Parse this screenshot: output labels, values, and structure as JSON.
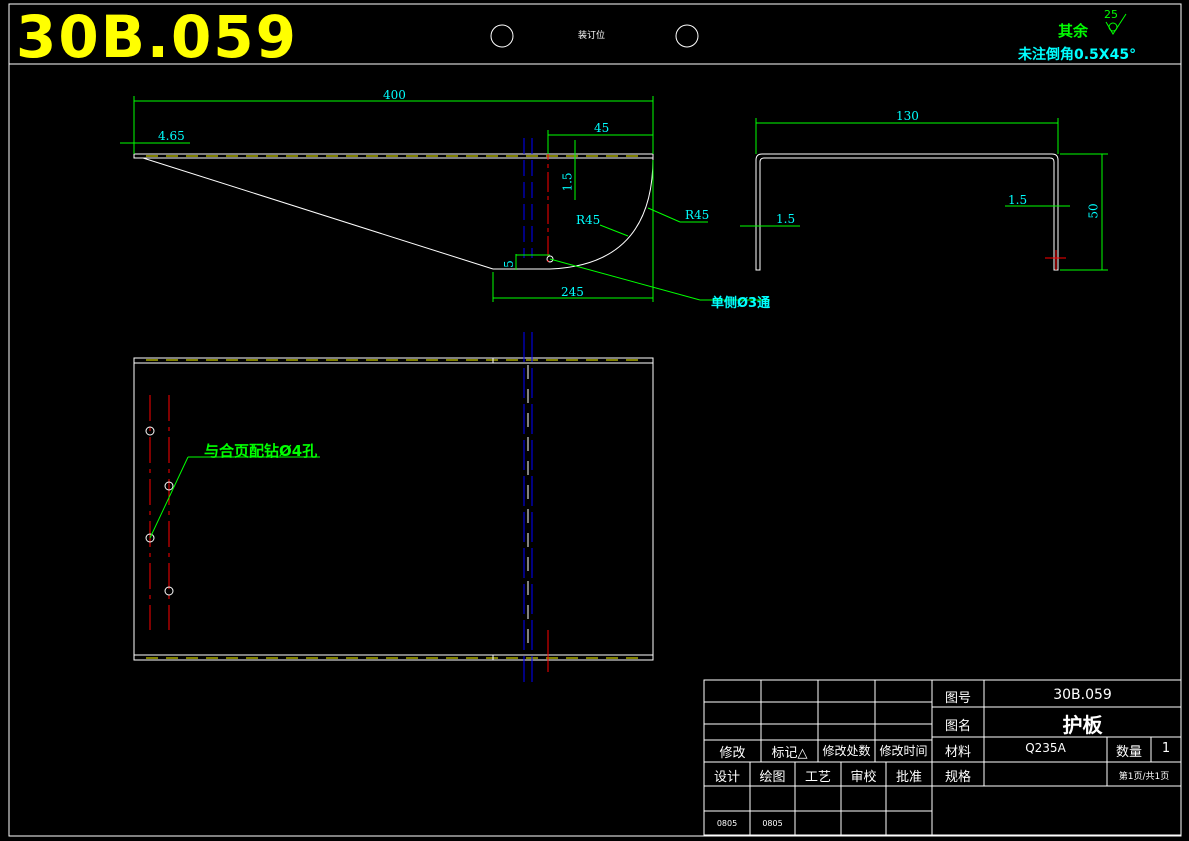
{
  "header": {
    "drawing_number_large": "30B.059",
    "binding_label": "装订位"
  },
  "surface": {
    "rough_label": "其余",
    "rough_value": "25",
    "chamfer_note": "未注倒角0.5X45°"
  },
  "front_view": {
    "dim_total_length": "400",
    "dim_left_offset": "4.65",
    "dim_right_top": "45",
    "dim_thickness": "1.5",
    "dim_radius_inner": "R45",
    "dim_radius_outer": "R45",
    "dim_hole_offset": "5",
    "dim_bottom_length": "245",
    "hole_note": "单侧Ø3通"
  },
  "side_view": {
    "dim_width": "130",
    "dim_thickness_left": "1.5",
    "dim_thickness_right": "1.5",
    "dim_height": "50"
  },
  "top_view": {
    "hole_note": "与合页配钻Ø4孔"
  },
  "title_block": {
    "revision_headers": [
      "修改",
      "标记△",
      "修改处数",
      "修改时间"
    ],
    "sign_headers": [
      "设计",
      "绘图",
      "工艺",
      "审校",
      "批准"
    ],
    "dates": [
      "0805",
      "0805"
    ],
    "drawing_no_label": "图号",
    "drawing_no_value": "30B.059",
    "name_label": "图名",
    "name_value": "护板",
    "material_label": "材料",
    "material_value": "Q235A",
    "quantity_label": "数量",
    "quantity_value": "1",
    "spec_label": "规格",
    "sheet_value": "第1页/共1页"
  },
  "colors": {
    "outline": "#ffffff",
    "dimension": "#00ff00",
    "dim_text": "#00ffff",
    "hidden": "#ffff00",
    "center": "#ff0000",
    "blue": "#0000ff",
    "title": "#ffff00"
  }
}
